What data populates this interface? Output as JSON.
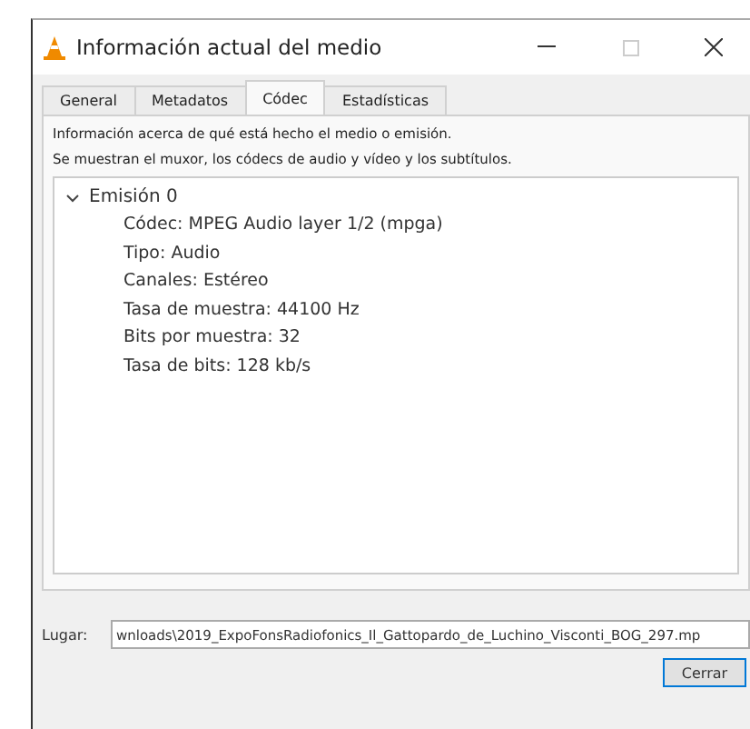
{
  "window": {
    "title": "Información actual del medio"
  },
  "tabs": [
    {
      "label": "General",
      "selected": false
    },
    {
      "label": "Metadatos",
      "selected": false
    },
    {
      "label": "Códec",
      "selected": true
    },
    {
      "label": "Estadísticas",
      "selected": false
    }
  ],
  "description": [
    "Información acerca de qué está hecho el medio o emisión.",
    "Se muestran el muxor, los códecs de audio y vídeo y los subtítulos."
  ],
  "tree": [
    {
      "label": "Emisión 0",
      "expanded": true,
      "children": [
        {
          "label": "Códec: MPEG Audio layer 1/2 (mpga)"
        },
        {
          "label": "Tipo: Audio"
        },
        {
          "label": "Canales: Estéreo"
        },
        {
          "label": "Tasa de muestra: 44100 Hz"
        },
        {
          "label": "Bits por muestra: 32"
        },
        {
          "label": "Tasa de bits: 128 kb/s"
        }
      ]
    }
  ],
  "location": {
    "label": "Lugar:",
    "value": "wnloads\\2019_ExpoFonsRadiofonics_Il_Gattopardo_de_Luchino_Visconti_BOG_297.mp"
  },
  "buttons": [
    "Cerrar"
  ]
}
